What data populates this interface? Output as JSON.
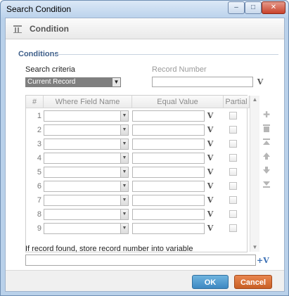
{
  "window": {
    "title": "Search Condition",
    "controls": {
      "minimize": "–",
      "maximize": "□",
      "close": "✕"
    }
  },
  "header": {
    "title": "Condition",
    "icon": "condition-icon"
  },
  "conditions": {
    "section_label": "Conditions",
    "search_criteria_label": "Search criteria",
    "search_criteria_value": "Current Record",
    "record_number_label": "Record Number",
    "record_number_value": "",
    "variable_button_label": "V"
  },
  "grid": {
    "columns": [
      "#",
      "Where Field Name",
      "Equal Value",
      "Partial"
    ],
    "rows": [
      {
        "num": "1",
        "field": "",
        "value": "",
        "partial": false
      },
      {
        "num": "2",
        "field": "",
        "value": "",
        "partial": false
      },
      {
        "num": "3",
        "field": "",
        "value": "",
        "partial": false
      },
      {
        "num": "4",
        "field": "",
        "value": "",
        "partial": false
      },
      {
        "num": "5",
        "field": "",
        "value": "",
        "partial": false
      },
      {
        "num": "6",
        "field": "",
        "value": "",
        "partial": false
      },
      {
        "num": "7",
        "field": "",
        "value": "",
        "partial": false
      },
      {
        "num": "8",
        "field": "",
        "value": "",
        "partial": false
      },
      {
        "num": "9",
        "field": "",
        "value": "",
        "partial": false
      }
    ],
    "side_tools": [
      "add-icon",
      "delete-icon",
      "move-top-icon",
      "move-up-icon",
      "move-down-icon",
      "move-bottom-icon"
    ]
  },
  "store": {
    "label": "If record found, store record number into variable",
    "value": "",
    "variable_button_label": "+V"
  },
  "footer": {
    "ok_label": "OK",
    "cancel_label": "Cancel"
  },
  "colors": {
    "ok": "#3d88c2",
    "cancel": "#c85f25",
    "section_label": "#3e5f8a"
  }
}
